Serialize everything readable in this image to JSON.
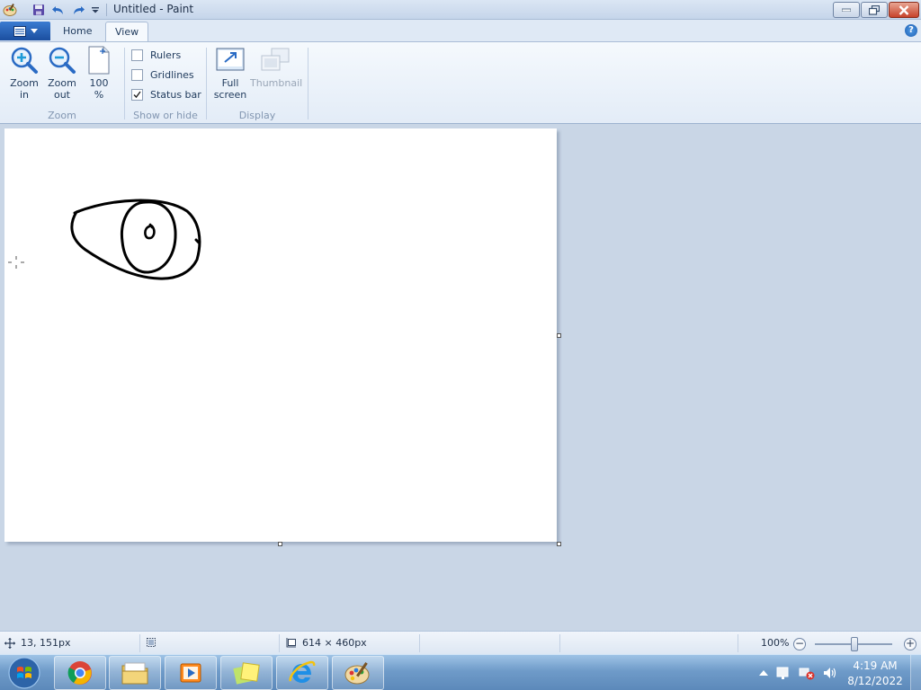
{
  "window": {
    "title": "Untitled - Paint"
  },
  "tabs": [
    {
      "label": "Home",
      "active": false
    },
    {
      "label": "View",
      "active": true
    }
  ],
  "ribbon": {
    "zoom_group": {
      "label": "Zoom",
      "buttons": [
        {
          "line1": "Zoom",
          "line2": "in",
          "icon": "zoom-in-icon"
        },
        {
          "line1": "Zoom",
          "line2": "out",
          "icon": "zoom-out-icon"
        },
        {
          "line1": "100",
          "line2": "%",
          "icon": "page-100-icon"
        }
      ]
    },
    "show_hide_group": {
      "label": "Show or hide",
      "checkboxes": [
        {
          "label": "Rulers",
          "checked": false
        },
        {
          "label": "Gridlines",
          "checked": false
        },
        {
          "label": "Status bar",
          "checked": true
        }
      ]
    },
    "display_group": {
      "label": "Display",
      "buttons": [
        {
          "line1": "Full",
          "line2": "screen",
          "icon": "full-screen-icon",
          "enabled": true
        },
        {
          "line1": "Thumbnail",
          "line2": "",
          "icon": "thumbnail-icon",
          "enabled": false
        }
      ]
    }
  },
  "canvas": {
    "background": "#ffffff",
    "drawing": "eye-sketch"
  },
  "statusbar": {
    "cursor_position": "13, 151px",
    "canvas_size": "614 × 460px",
    "zoom": "100%",
    "zoom_level": 1.0
  },
  "taskbar": {
    "apps": [
      {
        "icon": "chrome-icon"
      },
      {
        "icon": "file-explorer-icon"
      },
      {
        "icon": "media-player-icon"
      },
      {
        "icon": "sticky-notes-icon"
      },
      {
        "icon": "internet-explorer-icon"
      },
      {
        "icon": "paint-icon"
      }
    ],
    "clock": {
      "time": "4:19 AM",
      "date": "8/12/2022"
    }
  },
  "colors": {
    "accent": "#1b4f9f",
    "ribbon_bg": "#f5f9fd",
    "workspace_bg": "#c9d6e6"
  }
}
